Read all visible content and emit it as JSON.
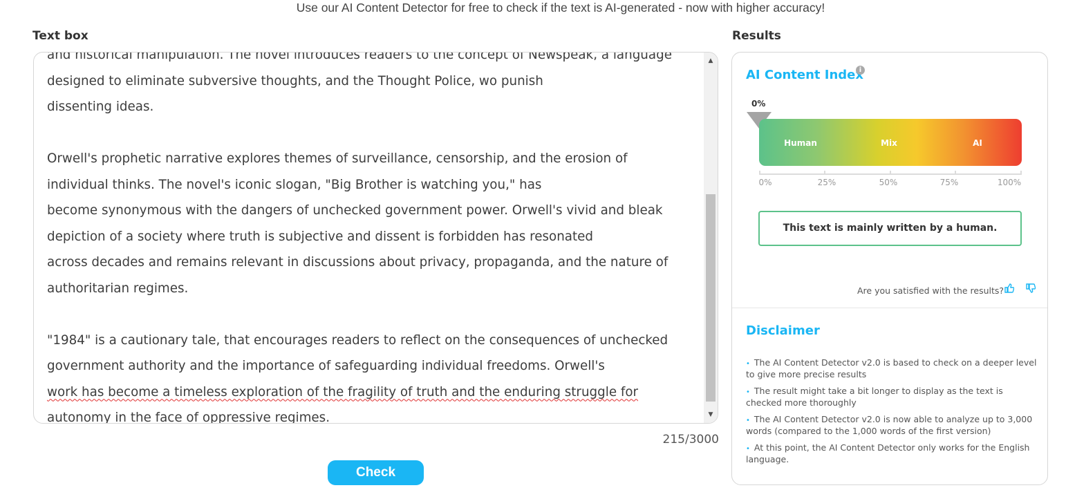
{
  "header": {
    "tagline": "Use our AI Content Detector for free to check if the text is AI-generated - now with higher accuracy!"
  },
  "labels": {
    "text_box": "Text box",
    "results": "Results"
  },
  "editor": {
    "lines": [
      "and historical manipulation. The novel introduces readers to the concept of Newspeak, a language",
      "designed to eliminate subversive thoughts, and the Thought Police, wo punish",
      "dissenting ideas.",
      "",
      "Orwell's prophetic narrative explores themes of surveillance, censorship, and the erosion of",
      "individual thinks. The novel's iconic slogan, \"Big Brother is watching you,\" has",
      "become synonymous with the dangers of unchecked government power. Orwell's vivid and bleak",
      "depiction of a society where truth is subjective and dissent is forbidden has resonated",
      "across decades and remains relevant in discussions about privacy, propaganda, and the nature of",
      "authoritarian regimes.",
      "",
      "\"1984\" is a cautionary tale, that encourages readers to reflect on the consequences of unchecked",
      "government authority and the importance of safeguarding individual freedoms. Orwell's",
      "work has become a timeless exploration of the fragility of truth and the enduring struggle for",
      "autonomy in the face of oppressive regimes."
    ],
    "word_count": "215/3000"
  },
  "check_button": "Check",
  "results": {
    "title": "AI Content Index",
    "info_icon": "i",
    "score": "0%",
    "score_value": 0,
    "bar_labels": [
      "Human",
      "Mix",
      "AI"
    ],
    "scale": [
      "0%",
      "25%",
      "50%",
      "75%",
      "100%"
    ],
    "verdict": "This text is mainly written by a human.",
    "feedback_prompt": "Are you satisfied with the results?",
    "accent_color": "#1ab6f4",
    "human_color": "#5cc28a"
  },
  "disclaimer": {
    "title": "Disclaimer",
    "items": [
      "The AI Content Detector v2.0 is based to check on a deeper level to give more precise results",
      "The result might take a bit longer to display as the text is checked more thoroughly",
      "The AI Content Detector v2.0 is now able to analyze up to 3,000 words (compared to the 1,000 words of the first version)",
      "At this point, the AI Content Detector only works for the English language."
    ]
  }
}
